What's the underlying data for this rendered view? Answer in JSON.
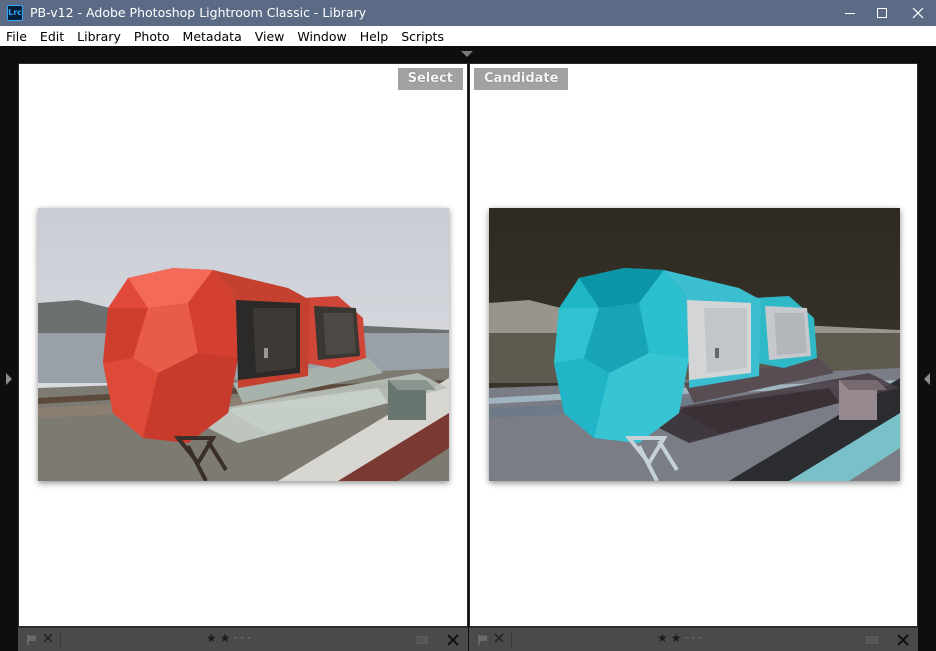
{
  "window": {
    "icon_text": "Lrc",
    "title": "PB-v12 - Adobe Photoshop Lightroom Classic - Library"
  },
  "menu": [
    "File",
    "Edit",
    "Library",
    "Photo",
    "Metadata",
    "View",
    "Window",
    "Help",
    "Scripts"
  ],
  "compare": {
    "select_label": "Select",
    "candidate_label": "Candidate"
  },
  "infobar": {
    "select": {
      "rating": 2,
      "max_rating": 5
    },
    "candidate": {
      "rating": 2,
      "max_rating": 5
    }
  },
  "colors": {
    "titlebar": "#5b6b86",
    "pane_bg": "#ffffff",
    "label_bg": "#a2a2a2",
    "infobar_bg": "#4a4a4a"
  }
}
